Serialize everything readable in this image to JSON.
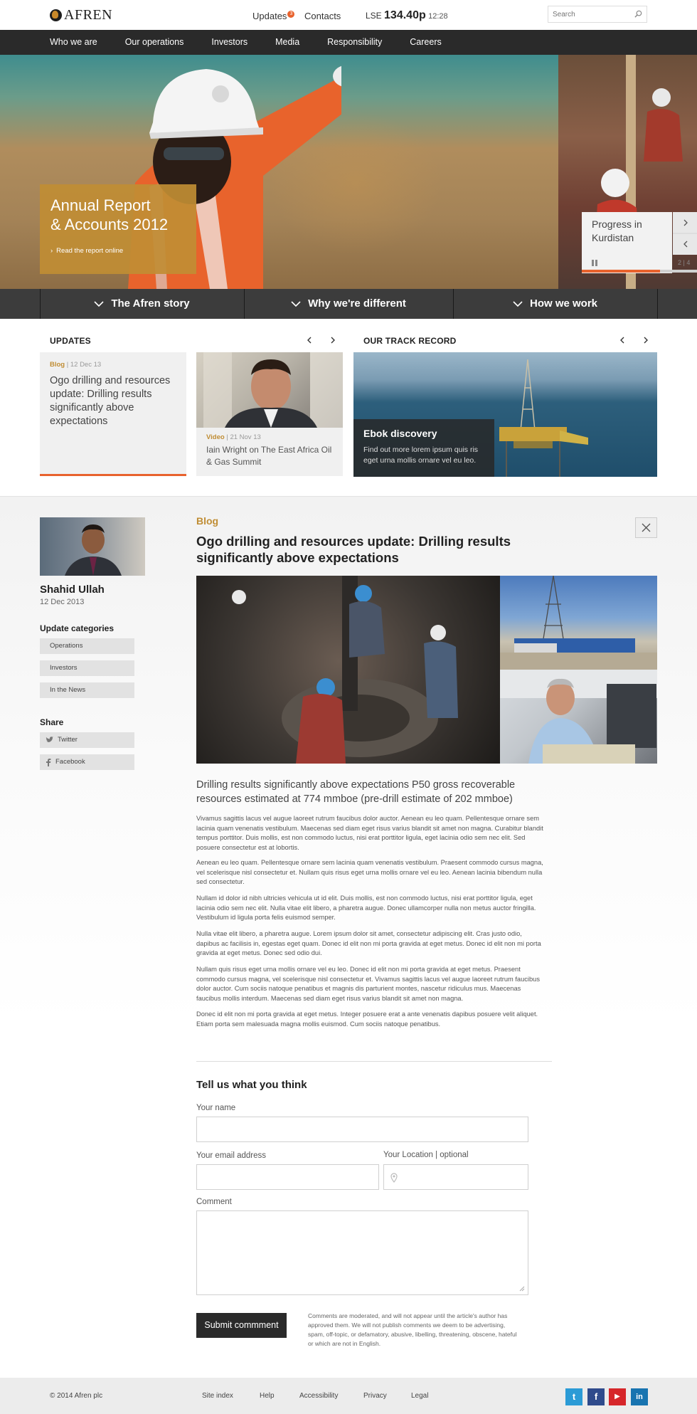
{
  "header": {
    "logo_text": "AFREN",
    "updates_label": "Updates",
    "updates_count": "3",
    "contacts_label": "Contacts",
    "lse_label": "LSE",
    "lse_price": "134.40p",
    "lse_time": "12:28",
    "search_placeholder": "Search"
  },
  "nav": {
    "items": [
      "Who we are",
      "Our operations",
      "Investors",
      "Media",
      "Responsibility",
      "Careers"
    ]
  },
  "hero": {
    "title_line1": "Annual Report",
    "title_line2": "& Accounts 2012",
    "link_label": "Read the report online",
    "side_card_title_line1": "Progress in",
    "side_card_title_line2": "Kurdistan",
    "slide_counter": "2 | 4",
    "slide_progress_percent": 68
  },
  "story_bar": {
    "items": [
      "The Afren story",
      "Why we're different",
      "How we work"
    ]
  },
  "updates": {
    "heading": "UPDATES",
    "card1": {
      "category": "Blog",
      "date": "12 Dec 13",
      "title": "Ogo drilling and resources update: Drilling results significantly above expectations"
    },
    "card2": {
      "category": "Video",
      "date": "21 Nov 13",
      "title": "Iain Wright on The East Africa Oil & Gas Summit"
    }
  },
  "track_record": {
    "heading": "OUR TRACK RECORD",
    "title": "Ebok discovery",
    "subtitle": "Find out more lorem ipsum quis ris eget urna mollis ornare vel eu leo."
  },
  "author": {
    "name": "Shahid Ullah",
    "date": "12 Dec 2013"
  },
  "sidebar": {
    "categories_heading": "Update categories",
    "categories": [
      "Operations",
      "Investors",
      "In the News"
    ],
    "share_heading": "Share",
    "share": [
      "Twitter",
      "Facebook"
    ]
  },
  "article": {
    "category": "Blog",
    "title": "Ogo drilling and resources update: Drilling results significantly above expectations",
    "lead": "Drilling results significantly above expectations P50 gross recoverable resources estimated at 774 mmboe (pre-drill estimate of 202 mmboe)",
    "paragraphs": [
      "Vivamus sagittis lacus vel augue laoreet rutrum faucibus dolor auctor. Aenean eu leo quam. Pellentesque ornare sem lacinia quam venenatis vestibulum. Maecenas sed diam eget risus varius blandit sit amet non magna. Curabitur blandit tempus porttitor. Duis mollis, est non commodo luctus, nisi erat porttitor ligula, eget lacinia odio sem nec elit. Sed posuere consectetur est at lobortis.",
      "Aenean eu leo quam. Pellentesque ornare sem lacinia quam venenatis vestibulum. Praesent commodo cursus magna, vel scelerisque nisl consectetur et. Nullam quis risus eget urna mollis ornare vel eu leo. Aenean lacinia bibendum nulla sed consectetur.",
      "Nullam id dolor id nibh ultricies vehicula ut id elit. Duis mollis, est non commodo luctus, nisi erat porttitor ligula, eget lacinia odio sem nec elit. Nulla vitae elit libero, a pharetra augue. Donec ullamcorper nulla non metus auctor fringilla. Vestibulum id ligula porta felis euismod semper.",
      "Nulla vitae elit libero, a pharetra augue. Lorem ipsum dolor sit amet, consectetur adipiscing elit. Cras justo odio, dapibus ac facilisis in, egestas eget quam. Donec id elit non mi porta gravida at eget metus. Donec id elit non mi porta gravida at eget metus. Donec sed odio dui.",
      "Nullam quis risus eget urna mollis ornare vel eu leo. Donec id elit non mi porta gravida at eget metus. Praesent commodo cursus magna, vel scelerisque nisl consectetur et. Vivamus sagittis lacus vel augue laoreet rutrum faucibus dolor auctor. Cum sociis natoque penatibus et magnis dis parturient montes, nascetur ridiculus mus. Maecenas faucibus mollis interdum. Maecenas sed diam eget risus varius blandit sit amet non magna.",
      "Donec id elit non mi porta gravida at eget metus. Integer posuere erat a ante venenatis dapibus posuere velit aliquet. Etiam porta sem malesuada magna mollis euismod. Cum sociis natoque penatibus."
    ]
  },
  "form": {
    "heading": "Tell us what you think",
    "name_label": "Your name",
    "email_label": "Your email address",
    "location_label": "Your Location | optional",
    "comment_label": "Comment",
    "submit_label": "Submit commment",
    "disclaimer": "Comments are moderated, and will not appear until the article's author has approved them. We will not publish comments we deem to be advertising, spam, off-topic, or defamatory, abusive, libelling, threatening, obscene, hateful or which are not in English."
  },
  "footer": {
    "copyright": "© 2014 Afren plc",
    "links": [
      "Site index",
      "Help",
      "Accessibility",
      "Privacy",
      "Legal"
    ],
    "social": [
      {
        "name": "twitter",
        "glyph": "t",
        "color": "#2b9bd6"
      },
      {
        "name": "facebook",
        "glyph": "f",
        "color": "#2f4b8c"
      },
      {
        "name": "youtube",
        "glyph": "▶",
        "color": "#d6262a"
      },
      {
        "name": "linkedin",
        "glyph": "in",
        "color": "#1874b0"
      }
    ]
  },
  "colors": {
    "accent_orange": "#e8622d",
    "gold": "#c08d34",
    "dark": "#2a2a2a"
  }
}
